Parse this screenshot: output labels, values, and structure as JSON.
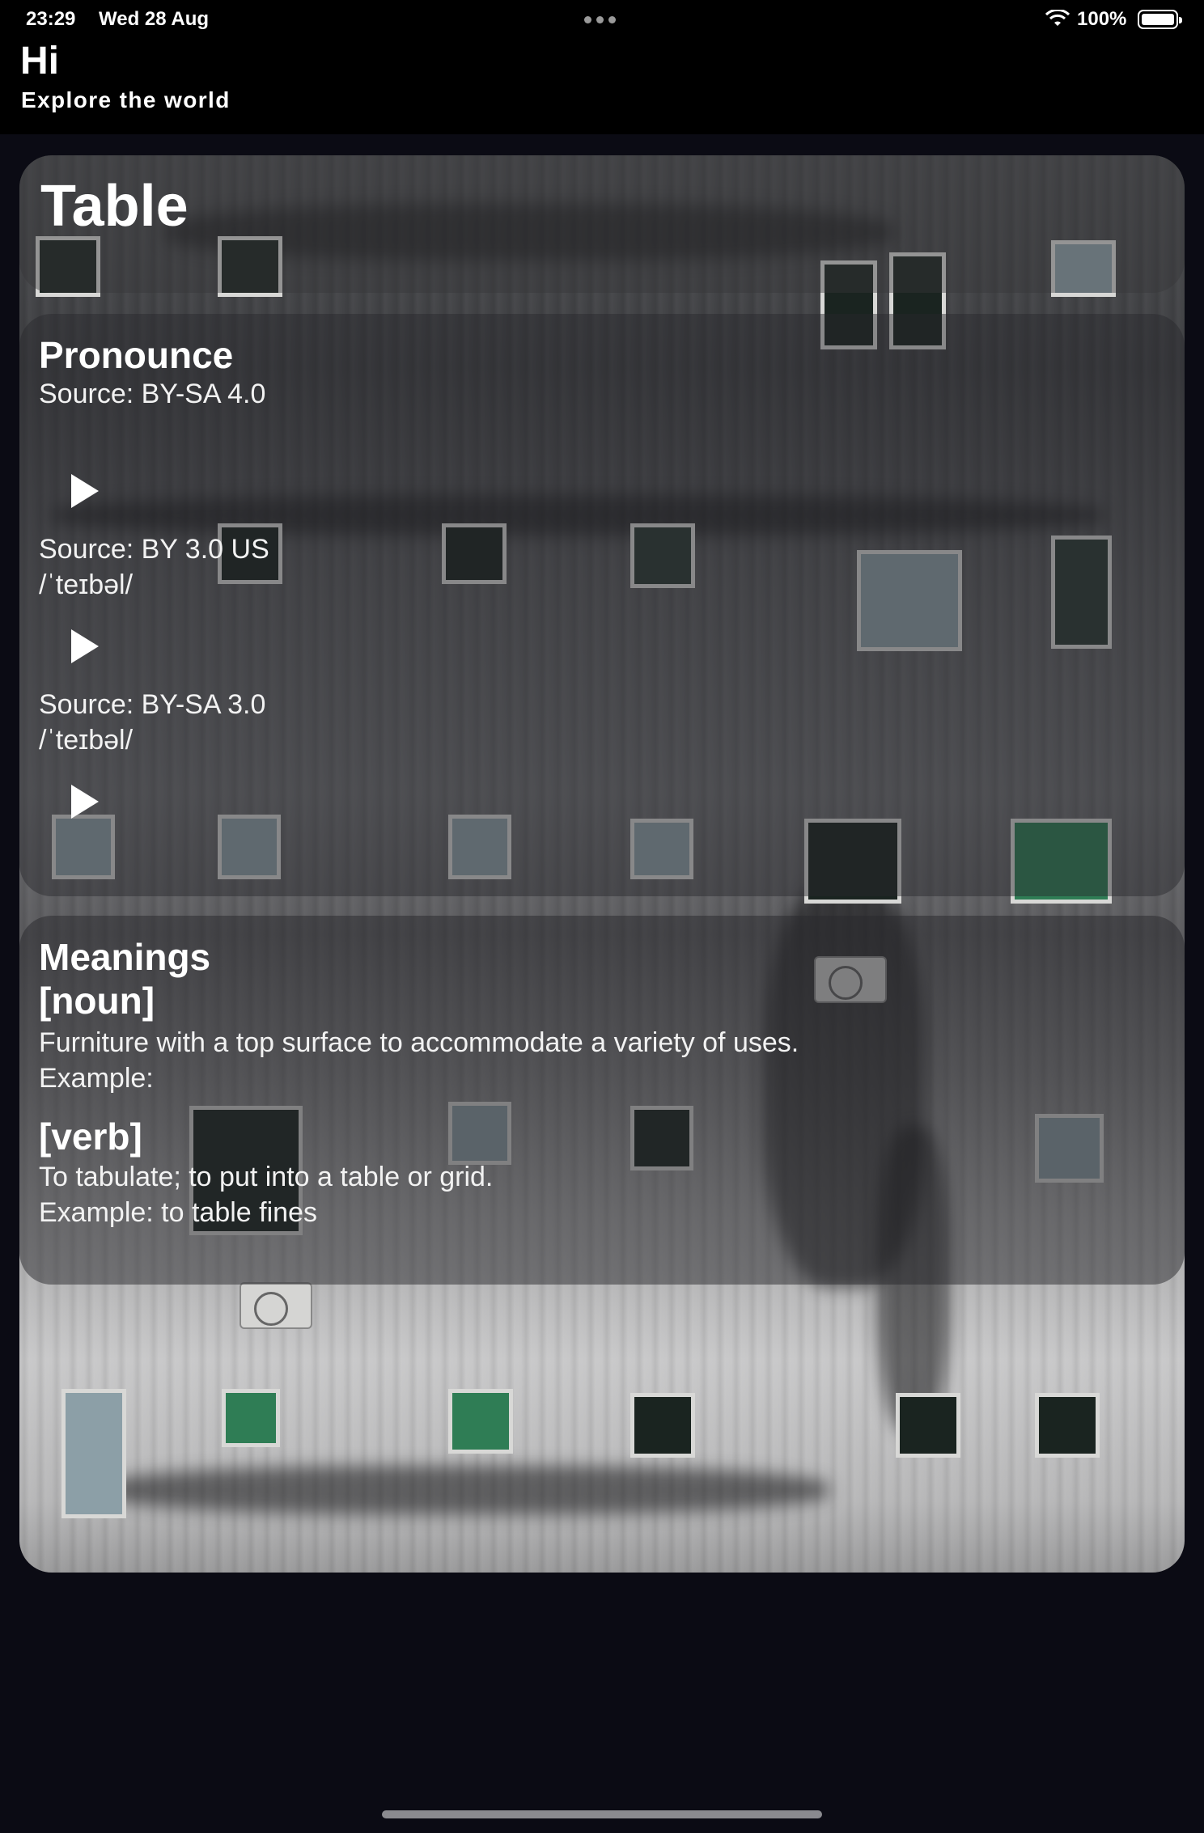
{
  "status_bar": {
    "time": "23:29",
    "date": "Wed 28 Aug",
    "battery": "100%"
  },
  "header": {
    "greeting": "Hi",
    "subtitle": "Explore the world"
  },
  "word": {
    "title": "Table"
  },
  "pronounce": {
    "heading": "Pronounce",
    "entries": [
      {
        "source": "Source: BY-SA 4.0",
        "ipa": ""
      },
      {
        "source": "Source: BY 3.0 US",
        "ipa": "/ˈteɪbəl/"
      },
      {
        "source": "Source: BY-SA 3.0",
        "ipa": "/ˈteɪbəl/"
      }
    ]
  },
  "meanings": {
    "heading": "Meanings",
    "items": [
      {
        "pos": "[noun]",
        "definition": "Furniture with a top surface to accommodate a variety of uses.",
        "example": "Example:"
      },
      {
        "pos": "[verb]",
        "definition": "To tabulate; to put into a table or grid.",
        "example": "Example: to table fines"
      }
    ]
  },
  "icons": {
    "play": "play-icon",
    "wifi": "wifi-icon",
    "battery": "battery-icon",
    "more": "more-dots-icon"
  }
}
